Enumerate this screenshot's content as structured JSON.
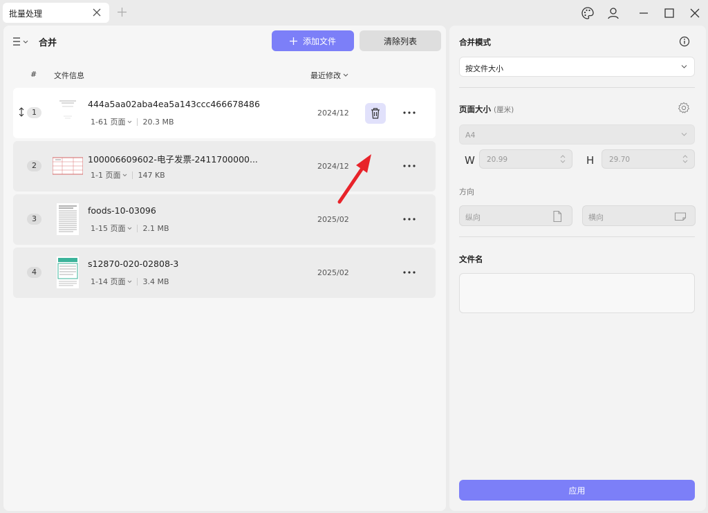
{
  "tab": {
    "title": "批量处理"
  },
  "toolbar": {
    "mode_title": "合并",
    "add_label": "添加文件",
    "clear_label": "清除列表"
  },
  "list_header": {
    "index": "#",
    "file_info": "文件信息",
    "modified": "最近修改"
  },
  "files": [
    {
      "index": "1",
      "name": "444a5aa02aba4ea5a143ccc466678486",
      "pages": "1-61 页面",
      "size": "20.3 MB",
      "date": "2024/12"
    },
    {
      "index": "2",
      "name": "100006609602-电子发票-2411700000...",
      "pages": "1-1 页面",
      "size": "147 KB",
      "date": "2024/12"
    },
    {
      "index": "3",
      "name": "foods-10-03096",
      "pages": "1-15 页面",
      "size": "2.1 MB",
      "date": "2025/02"
    },
    {
      "index": "4",
      "name": "s12870-020-02808-3",
      "pages": "1-14 页面",
      "size": "3.4 MB",
      "date": "2025/02"
    }
  ],
  "settings": {
    "merge_mode_label": "合并模式",
    "merge_mode_value": "按文件大小",
    "page_size_label": "页面大小",
    "page_size_unit": "(厘米)",
    "page_size_value": "A4",
    "width_label": "W",
    "width_value": "20.99",
    "height_label": "H",
    "height_value": "29.70",
    "orientation_label": "方向",
    "portrait_label": "纵向",
    "landscape_label": "横向",
    "filename_label": "文件名",
    "apply_label": "应用"
  },
  "colors": {
    "accent": "#7c7ff8",
    "arrow": "#e8232a"
  }
}
